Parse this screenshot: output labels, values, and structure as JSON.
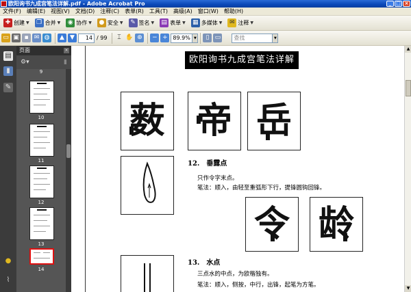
{
  "window": {
    "title": "欧阳询书九成宫笔法详解.pdf - Adobe Acrobat Pro",
    "min": "_",
    "max": "□",
    "close": "×"
  },
  "menu": [
    "文件(F)",
    "编辑(E)",
    "视图(V)",
    "文档(D)",
    "注释(C)",
    "表单(R)",
    "工具(T)",
    "高级(A)",
    "窗口(W)",
    "帮助(H)"
  ],
  "toolbar1": {
    "create": "创建",
    "combine": "合并",
    "collaborate": "协作",
    "secure": "安全",
    "sign": "签名",
    "forms": "表单",
    "multimedia": "多媒体",
    "comment": "注释"
  },
  "toolbar2": {
    "current_page": "14",
    "total_pages": "/ 99",
    "zoom": "89.9%",
    "find_placeholder": "查找"
  },
  "panel": {
    "title": "页面",
    "thumbnails": [
      {
        "label": "9"
      },
      {
        "label": "10"
      },
      {
        "label": "11"
      },
      {
        "label": "12"
      },
      {
        "label": "13"
      },
      {
        "label": "14"
      }
    ],
    "selected_index": 5
  },
  "document": {
    "banner": "欧阳询书九成宫笔法详解",
    "row1_chars": [
      "薮",
      "帝",
      "岳"
    ],
    "section12": {
      "heading": "12.　垂露点",
      "line1": "只作令字末点。",
      "line2": "笔法：顺入，由轻至重弧形下行，提锋圆钩回锋。"
    },
    "row2_chars": [
      "令",
      "龄"
    ],
    "section13": {
      "heading": "13.　水点",
      "line1": "三点水的中点，为欧楷独有。",
      "line2": "笔法：顺入，侧按，中行，出锋，起笔为方笔。"
    }
  },
  "colors": {
    "titlebar": "#0a48b8",
    "panel_bg": "#4a4a4a",
    "selected_thumb": "#e01010"
  }
}
